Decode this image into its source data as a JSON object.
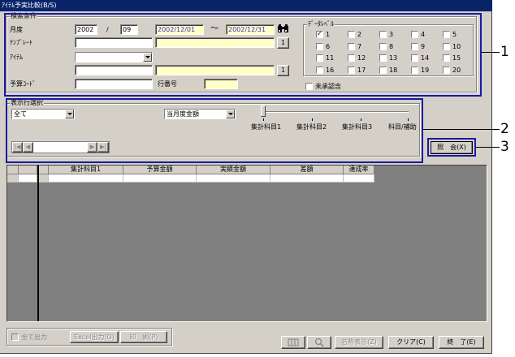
{
  "window": {
    "title": "ｱｲﾃﾑ予実比較(B/S)"
  },
  "search": {
    "group_label": "検索条件",
    "month_label": "月度",
    "year_value": "2002",
    "slash": "/",
    "month_value": "09",
    "date_from": "2002/12/01",
    "tilde": "～",
    "date_to": "2002/12/31",
    "template_label": "ﾃﾝﾌﾟﾚｰﾄ",
    "template_button": "1",
    "item_label": "ｱｲﾃﾑ",
    "item_button": "1",
    "budget_code_label": "予算ｺｰﾄﾞ",
    "line_no_label": "行番号"
  },
  "data_level": {
    "group_label": "ﾃﾞｰﾀﾚﾍﾞﾙ",
    "checkboxes": [
      {
        "label": "1",
        "checked": true
      },
      {
        "label": "2",
        "checked": false
      },
      {
        "label": "3",
        "checked": false
      },
      {
        "label": "4",
        "checked": false
      },
      {
        "label": "5",
        "checked": false
      },
      {
        "label": "6",
        "checked": false
      },
      {
        "label": "7",
        "checked": false
      },
      {
        "label": "8",
        "checked": false
      },
      {
        "label": "9",
        "checked": false
      },
      {
        "label": "10",
        "checked": false
      },
      {
        "label": "11",
        "checked": false
      },
      {
        "label": "12",
        "checked": false
      },
      {
        "label": "13",
        "checked": false
      },
      {
        "label": "14",
        "checked": false
      },
      {
        "label": "15",
        "checked": false
      },
      {
        "label": "16",
        "checked": false
      },
      {
        "label": "17",
        "checked": false
      },
      {
        "label": "18",
        "checked": false
      },
      {
        "label": "19",
        "checked": false
      },
      {
        "label": "20",
        "checked": false
      }
    ],
    "unapproved_label": "未承認含",
    "unapproved_checked": false
  },
  "display": {
    "group_label": "表示行選択",
    "row_select_value": "全て",
    "amount_select_value": "当月度金額",
    "slider_labels": [
      "集計科目1",
      "集計科目2",
      "集計科目3",
      "科目/補助"
    ],
    "slider_level": 0,
    "inquiry_button": "照　会(X)"
  },
  "grid": {
    "columns": [
      "集計科目1",
      "予算金額",
      "実績金額",
      "差額",
      "達成率"
    ]
  },
  "footer": {
    "all_output_label": "全て出力",
    "excel_button": "Excel出力(O)",
    "print_button": "印　刷(P)",
    "name_display_button": "名称表示(Z)",
    "clear_button": "クリア(C)",
    "exit_button": "終　了(E)"
  },
  "callouts": [
    "1",
    "2",
    "3"
  ],
  "colors": {
    "highlight_border": "#1a1aa0",
    "title_bar": "#0a246a",
    "input_yellow": "#ffffc8",
    "date_text": "#3333cc"
  }
}
